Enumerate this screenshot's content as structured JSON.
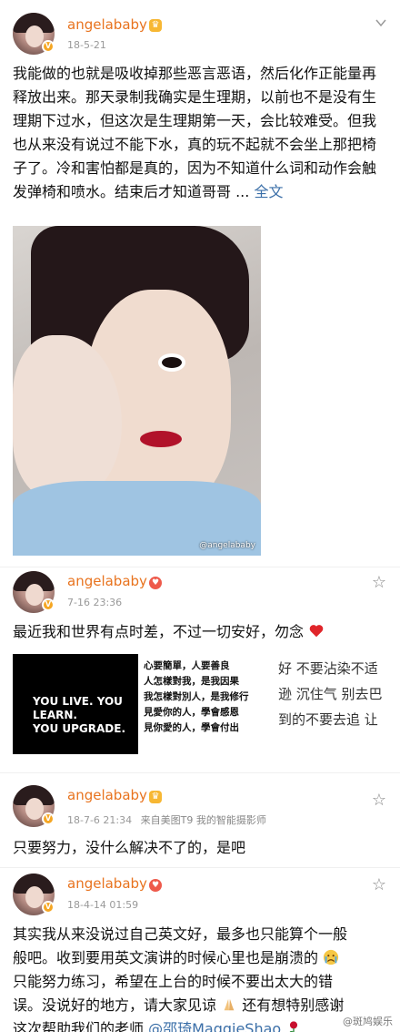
{
  "posts": [
    {
      "username": "angelababy",
      "time": "18-5-21",
      "text": "我能做的也就是吸收掉那些恶言恶语，然后化作正能量再释放出来。那天录制我确实是生理期，以前也不是没有生理期下过水，但这次是生理期第一天，会比较难受。但我也从来没有说过不能下水，真的玩不起就不会坐上那把椅子了。冷和害怕都是真的，因为不知道什么词和动作会触发弹椅和喷水。结束后才知道哥哥 ... ",
      "more_link": "全文",
      "image_watermark": "@angelababy"
    },
    {
      "username": "angelababy",
      "time": "7-16 23:36",
      "text": "最近我和世界有点时差，不过一切安好，勿念",
      "images": {
        "card1": [
          "YOU LIVE. YOU LEARN.",
          "YOU UPGRADE."
        ],
        "card2": [
          "心要簡單，人要善良",
          "人怎樣對我，是我因果",
          "我怎樣對別人，是我修行",
          "見愛你的人，學會感恩",
          "見你愛的人，學會付出"
        ],
        "card3": [
          "好 不要沾染不适",
          "逊 沉住气 别去巴",
          "到的不要去追 让"
        ]
      }
    },
    {
      "username": "angelababy",
      "time": "18-7-6 21:34",
      "source": "来自美图T9 我的智能摄影师",
      "text": "只要努力，没什么解决不了的，是吧"
    },
    {
      "username": "angelababy",
      "time": "18-4-14 01:59",
      "text_lines": [
        "其实我从来没说过自己英文好，最多也只能算个一般",
        "般吧。收到要用英文演讲的时候心里也是崩溃的",
        "只能努力练习，希望在上台的时候不要出太大的错",
        "误。没说好的地方，请大家见谅",
        "还有想特别感谢",
        "这次帮助我们的老师 ",
        "@邵琦MaggieShao"
      ],
      "watermark": "@斑鸠娱乐"
    }
  ],
  "colors": {
    "username": "#e8731e",
    "link": "#3b6fa8",
    "meta": "#999999"
  }
}
